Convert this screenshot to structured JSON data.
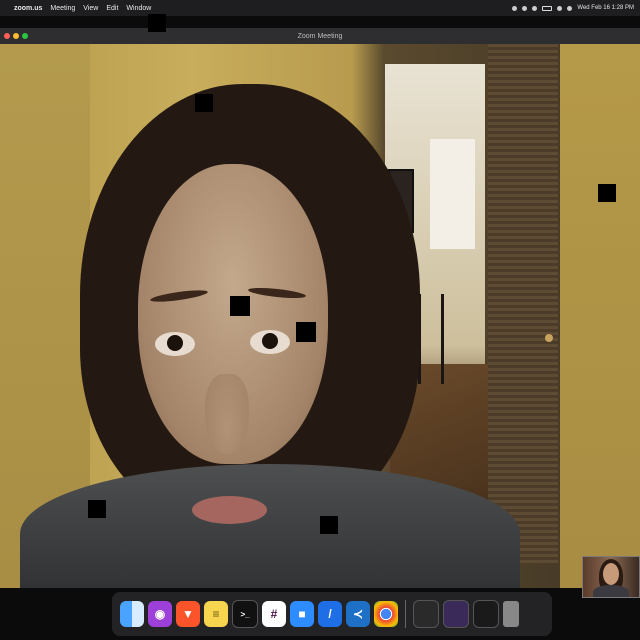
{
  "menubar": {
    "app_name": "zoom.us",
    "menus": [
      "Meeting",
      "View",
      "Edit",
      "Window"
    ],
    "clock": "Wed Feb 16  1:28 PM"
  },
  "window": {
    "title": "Zoom Meeting"
  },
  "dock": {
    "apps": [
      {
        "name": "Finder",
        "icon": "finder-icon"
      },
      {
        "name": "Podcasts",
        "icon": "podcasts-icon"
      },
      {
        "name": "Brave",
        "icon": "brave-icon"
      },
      {
        "name": "Notes",
        "icon": "notes-icon"
      },
      {
        "name": "Terminal",
        "icon": "terminal-icon"
      },
      {
        "name": "Slack",
        "icon": "slack-icon"
      },
      {
        "name": "Zoom",
        "icon": "zoom-icon"
      },
      {
        "name": "Safari",
        "icon": "safari-icon"
      },
      {
        "name": "Visual Studio Code",
        "icon": "vscode-icon"
      },
      {
        "name": "Chrome",
        "icon": "chrome-icon"
      }
    ]
  },
  "colors": {
    "menubar_bg": "#1e1e20",
    "close": "#ff5f57",
    "minimize": "#febc2e",
    "maximize": "#28c840",
    "zoom_blue": "#2d8cff"
  }
}
